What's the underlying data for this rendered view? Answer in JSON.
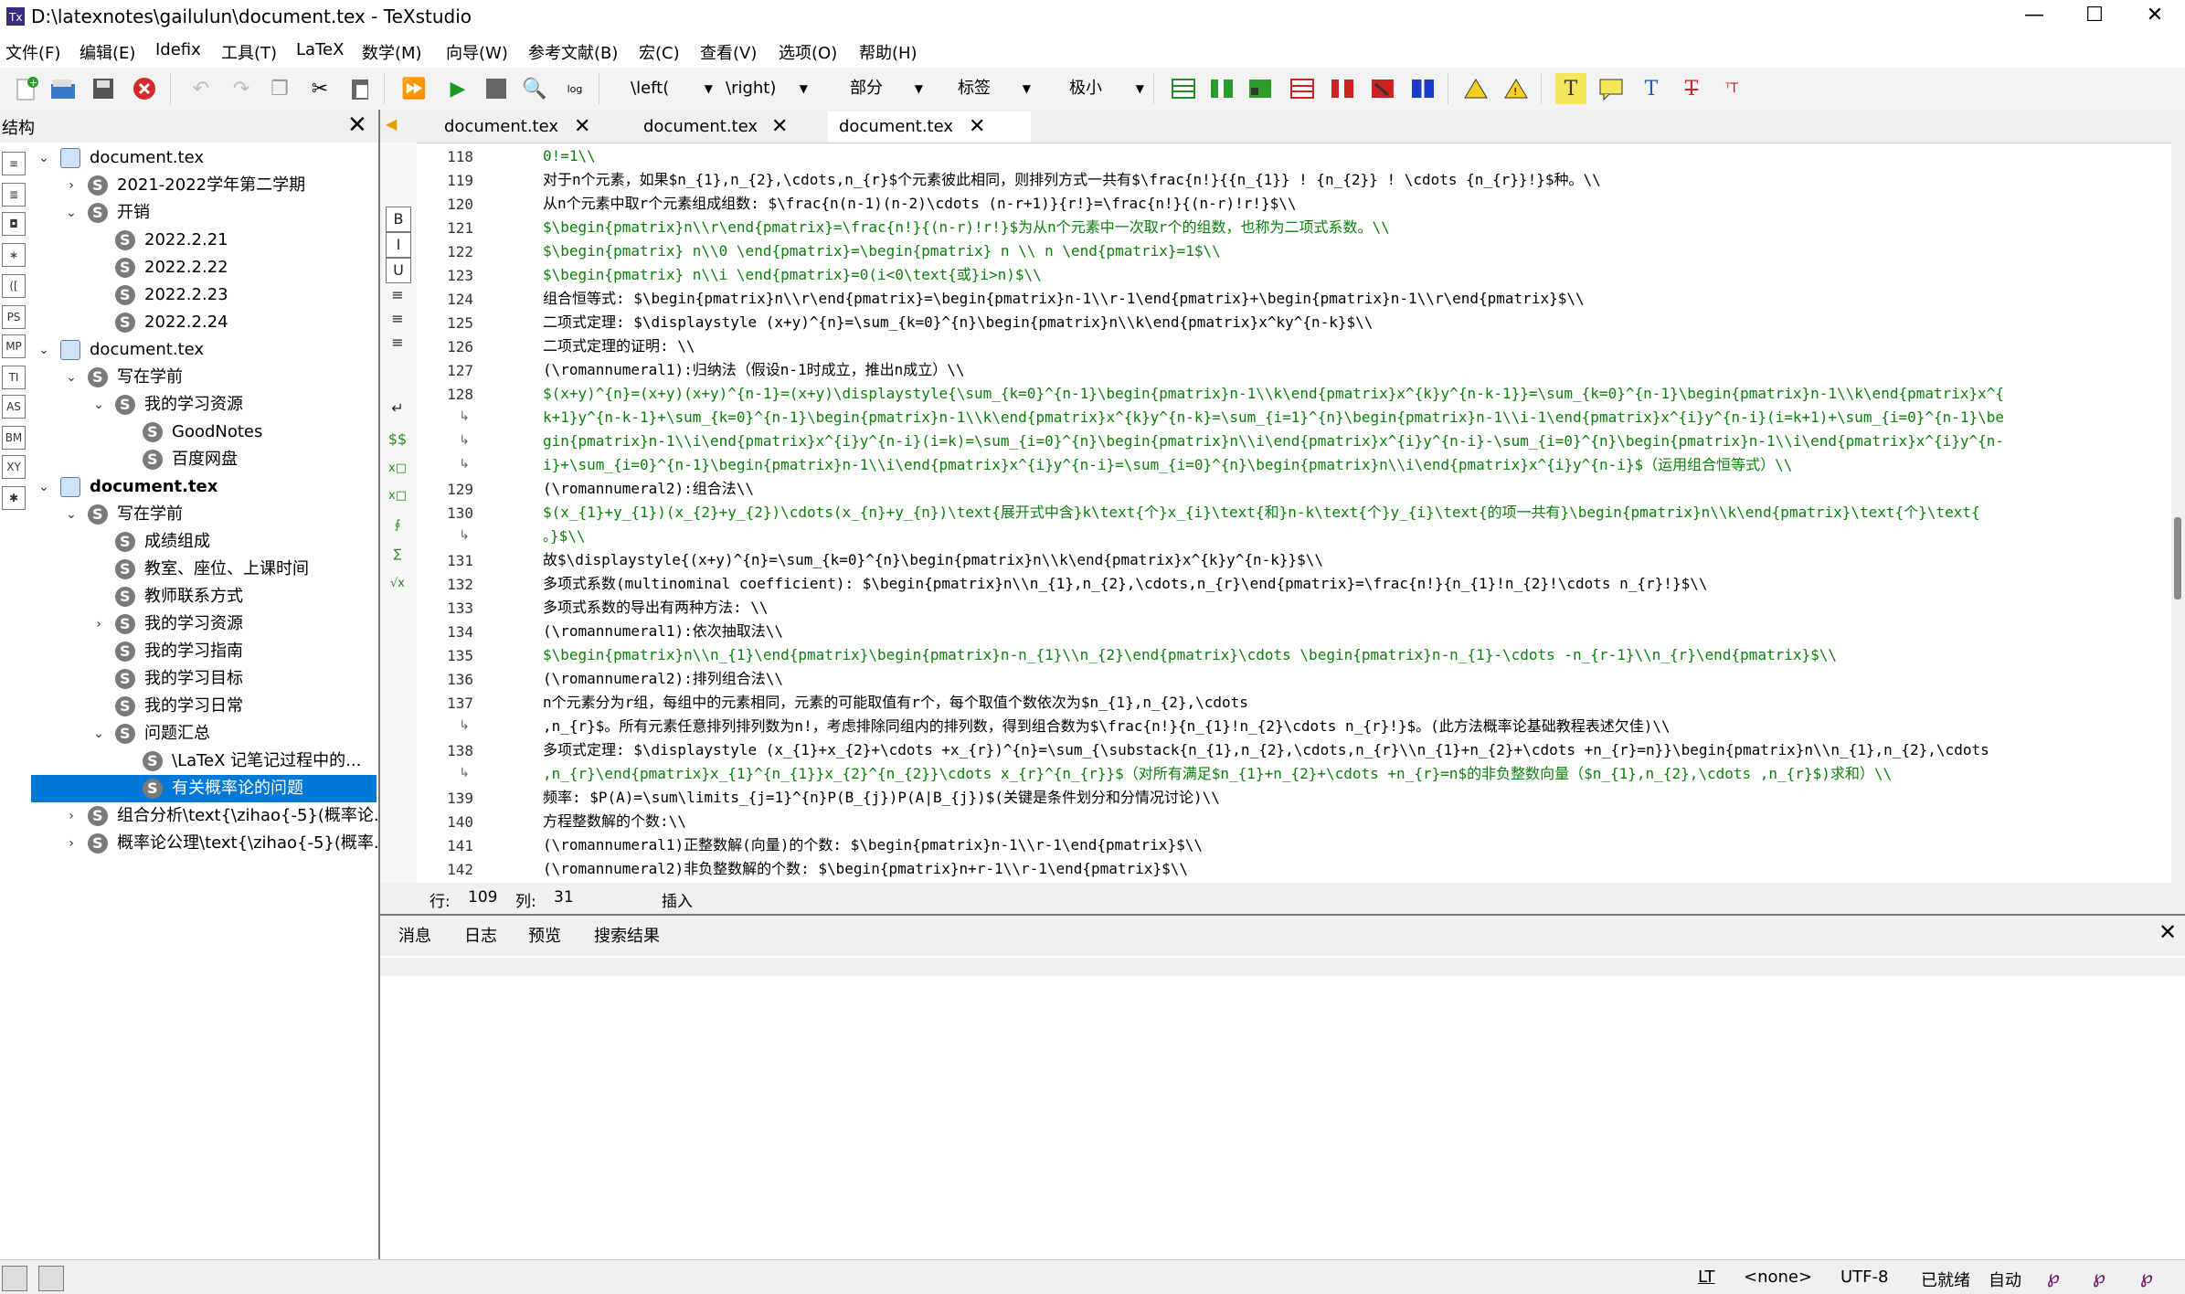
{
  "window": {
    "title": "D:\\latexnotes\\gailulun\\document.tex - TeXstudio",
    "minimize": "—",
    "maximize": "☐",
    "close": "✕"
  },
  "menu": [
    "文件(F)",
    "编辑(E)",
    "Idefix",
    "工具(T)",
    "LaTeX",
    "数学(M)",
    "向导(W)",
    "参考文献(B)",
    "宏(C)",
    "查看(V)",
    "选项(O)",
    "帮助(H)"
  ],
  "toolbar": {
    "combos": [
      "\\left(",
      "\\right)",
      "部分",
      "标签",
      "极小"
    ]
  },
  "structure": {
    "title": "结构",
    "close": "✕",
    "side_icons": [
      "≡",
      "≣",
      "◘",
      "∗",
      "([",
      "PS",
      "MP",
      "TI",
      "AS",
      "BM",
      "XY",
      "✱"
    ],
    "tree": [
      {
        "label": "document.tex",
        "level": 0,
        "type": "doc",
        "arrow": "⌄",
        "bold": false
      },
      {
        "label": "2021-2022学年第二学期",
        "level": 1,
        "type": "sec",
        "arrow": "›",
        "bold": false
      },
      {
        "label": "开销",
        "level": 1,
        "type": "sec",
        "arrow": "⌄",
        "bold": false
      },
      {
        "label": "2022.2.21",
        "level": 2,
        "type": "sec",
        "arrow": "",
        "bold": false
      },
      {
        "label": "2022.2.22",
        "level": 2,
        "type": "sec",
        "arrow": "",
        "bold": false
      },
      {
        "label": "2022.2.23",
        "level": 2,
        "type": "sec",
        "arrow": "",
        "bold": false
      },
      {
        "label": "2022.2.24",
        "level": 2,
        "type": "sec",
        "arrow": "",
        "bold": false
      },
      {
        "label": "document.tex",
        "level": 0,
        "type": "doc",
        "arrow": "⌄",
        "bold": false
      },
      {
        "label": "写在学前",
        "level": 1,
        "type": "sec",
        "arrow": "⌄",
        "bold": false
      },
      {
        "label": "我的学习资源",
        "level": 2,
        "type": "sec",
        "arrow": "⌄",
        "bold": false
      },
      {
        "label": "GoodNotes",
        "level": 3,
        "type": "sec",
        "arrow": "",
        "bold": false
      },
      {
        "label": "百度网盘",
        "level": 3,
        "type": "sec",
        "arrow": "",
        "bold": false
      },
      {
        "label": "document.tex",
        "level": 0,
        "type": "doc",
        "arrow": "⌄",
        "bold": true
      },
      {
        "label": "写在学前",
        "level": 1,
        "type": "sec",
        "arrow": "⌄",
        "bold": false
      },
      {
        "label": "成绩组成",
        "level": 2,
        "type": "sec",
        "arrow": "",
        "bold": false
      },
      {
        "label": "教室、座位、上课时间",
        "level": 2,
        "type": "sec",
        "arrow": "",
        "bold": false
      },
      {
        "label": "教师联系方式",
        "level": 2,
        "type": "sec",
        "arrow": "",
        "bold": false
      },
      {
        "label": "我的学习资源",
        "level": 2,
        "type": "sec",
        "arrow": "›",
        "bold": false
      },
      {
        "label": "我的学习指南",
        "level": 2,
        "type": "sec",
        "arrow": "",
        "bold": false
      },
      {
        "label": "我的学习目标",
        "level": 2,
        "type": "sec",
        "arrow": "",
        "bold": false
      },
      {
        "label": "我的学习日常",
        "level": 2,
        "type": "sec",
        "arrow": "",
        "bold": false
      },
      {
        "label": "问题汇总",
        "level": 2,
        "type": "sec",
        "arrow": "⌄",
        "bold": false
      },
      {
        "label": "\\LaTeX 记笔记过程中的...",
        "level": 3,
        "type": "sec",
        "arrow": "",
        "bold": false
      },
      {
        "label": "有关概率论的问题",
        "level": 3,
        "type": "sec",
        "arrow": "",
        "bold": false,
        "selected": true
      },
      {
        "label": "组合分析\\text{\\zihao{-5}(概率论...",
        "level": 1,
        "type": "sec",
        "arrow": "›",
        "bold": false
      },
      {
        "label": "概率论公理\\text{\\zihao{-5}(概率...",
        "level": 1,
        "type": "sec",
        "arrow": "›",
        "bold": false
      }
    ]
  },
  "editor": {
    "tabs": [
      "document.tex",
      "document.tex",
      "document.tex"
    ],
    "left_buttons": [
      "B",
      "I",
      "U",
      "≡",
      "≡",
      "≡",
      "↵",
      "$$",
      "x□",
      "x□",
      "∮",
      "∑",
      "√x"
    ],
    "lines": [
      {
        "n": "118",
        "text": "0!=1\\\\",
        "kind": "m"
      },
      {
        "n": "119",
        "text": "对于n个元素，如果$n_{1},n_{2},\\cdots,n_{r}$个元素彼此相同，则排列方式一共有$\\frac{n!}{{n_{1}} ! {n_{2}} ! \\cdots {n_{r}}!}$种。\\\\",
        "kind": "t"
      },
      {
        "n": "120",
        "text": "从n个元素中取r个元素组成组数: $\\frac{n(n-1)(n-2)\\cdots (n-r+1)}{r!}=\\frac{n!}{(n-r)!r!}$\\\\",
        "kind": "t"
      },
      {
        "n": "121",
        "text": "$\\begin{pmatrix}n\\\\r\\end{pmatrix}=\\frac{n!}{(n-r)!r!}$为从n个元素中一次取r个的组数，也称为二项式系数。\\\\",
        "kind": "m"
      },
      {
        "n": "122",
        "text": "$\\begin{pmatrix} n\\\\0 \\end{pmatrix}=\\begin{pmatrix} n \\\\ n \\end{pmatrix}=1$\\\\",
        "kind": "m"
      },
      {
        "n": "123",
        "text": "$\\begin{pmatrix} n\\\\i \\end{pmatrix}=0(i<0\\text{或}i>n)$\\\\",
        "kind": "m"
      },
      {
        "n": "124",
        "text": "组合恒等式: $\\begin{pmatrix}n\\\\r\\end{pmatrix}=\\begin{pmatrix}n-1\\\\r-1\\end{pmatrix}+\\begin{pmatrix}n-1\\\\r\\end{pmatrix}$\\\\",
        "kind": "t"
      },
      {
        "n": "125",
        "text": "二项式定理: $\\displaystyle (x+y)^{n}=\\sum_{k=0}^{n}\\begin{pmatrix}n\\\\k\\end{pmatrix}x^ky^{n-k}$\\\\",
        "kind": "t"
      },
      {
        "n": "126",
        "text": "二项式定理的证明: \\\\",
        "kind": "t"
      },
      {
        "n": "127",
        "text": "(\\romannumeral1):归纳法（假设n-1时成立，推出n成立）\\\\",
        "kind": "t"
      },
      {
        "n": "128",
        "text": "$(x+y)^{n}=(x+y)(x+y)^{n-1}=(x+y)\\displaystyle{\\sum_{k=0}^{n-1}\\begin{pmatrix}n-1\\\\k\\end{pmatrix}x^{k}y^{n-k-1}}=\\sum_{k=0}^{n-1}\\begin{pmatrix}n-1\\\\k\\end{pmatrix}x^{",
        "kind": "m"
      },
      {
        "n": "",
        "text": "k+1}y^{n-k-1}+\\sum_{k=0}^{n-1}\\begin{pmatrix}n-1\\\\k\\end{pmatrix}x^{k}y^{n-k}=\\sum_{i=1}^{n}\\begin{pmatrix}n-1\\\\i-1\\end{pmatrix}x^{i}y^{n-i}(i=k+1)+\\sum_{i=0}^{n-1}\\be",
        "kind": "m"
      },
      {
        "n": "",
        "text": "gin{pmatrix}n-1\\\\i\\end{pmatrix}x^{i}y^{n-i}(i=k)=\\sum_{i=0}^{n}\\begin{pmatrix}n\\\\i\\end{pmatrix}x^{i}y^{n-i}-\\sum_{i=0}^{n}\\begin{pmatrix}n-1\\\\i\\end{pmatrix}x^{i}y^{n-",
        "kind": "m"
      },
      {
        "n": "",
        "text": "i}+\\sum_{i=0}^{n-1}\\begin{pmatrix}n-1\\\\i\\end{pmatrix}x^{i}y^{n-i}=\\sum_{i=0}^{n}\\begin{pmatrix}n\\\\i\\end{pmatrix}x^{i}y^{n-i}$（运用组合恒等式）\\\\",
        "kind": "m"
      },
      {
        "n": "129",
        "text": "(\\romannumeral2):组合法\\\\",
        "kind": "t"
      },
      {
        "n": "130",
        "text": "$(x_{1}+y_{1})(x_{2}+y_{2})\\cdots(x_{n}+y_{n})\\text{展开式中含}k\\text{个}x_{i}\\text{和}n-k\\text{个}y_{i}\\text{的项一共有}\\begin{pmatrix}n\\\\k\\end{pmatrix}\\text{个}\\text{",
        "kind": "m"
      },
      {
        "n": "",
        "text": "。}$\\\\",
        "kind": "m"
      },
      {
        "n": "131",
        "text": "故$\\displaystyle{(x+y)^{n}=\\sum_{k=0}^{n}\\begin{pmatrix}n\\\\k\\end{pmatrix}x^{k}y^{n-k}}$\\\\",
        "kind": "t"
      },
      {
        "n": "132",
        "text": "多项式系数(multinominal coefficient): $\\begin{pmatrix}n\\\\n_{1},n_{2},\\cdots,n_{r}\\end{pmatrix}=\\frac{n!}{n_{1}!n_{2}!\\cdots n_{r}!}$\\\\",
        "kind": "t"
      },
      {
        "n": "133",
        "text": "多项式系数的导出有两种方法: \\\\",
        "kind": "t"
      },
      {
        "n": "134",
        "text": "(\\romannumeral1):依次抽取法\\\\",
        "kind": "t"
      },
      {
        "n": "135",
        "text": "$\\begin{pmatrix}n\\\\n_{1}\\end{pmatrix}\\begin{pmatrix}n-n_{1}\\\\n_{2}\\end{pmatrix}\\cdots \\begin{pmatrix}n-n_{1}-\\cdots -n_{r-1}\\\\n_{r}\\end{pmatrix}$\\\\",
        "kind": "m"
      },
      {
        "n": "136",
        "text": "(\\romannumeral2):排列组合法\\\\",
        "kind": "t"
      },
      {
        "n": "137",
        "text": "n个元素分为r组，每组中的元素相同，元素的可能取值有r个，每个取值个数依次为$n_{1},n_{2},\\cdots",
        "kind": "t"
      },
      {
        "n": "",
        "text": ",n_{r}$。所有元素任意排列排列数为n!，考虑排除同组内的排列数，得到组合数为$\\frac{n!}{n_{1}!n_{2}\\cdots n_{r}!}$。(此方法概率论基础教程表述欠佳)\\\\",
        "kind": "t"
      },
      {
        "n": "138",
        "text": "多项式定理: $\\displaystyle (x_{1}+x_{2}+\\cdots +x_{r})^{n}=\\sum_{\\substack{n_{1},n_{2},\\cdots,n_{r}\\\\n_{1}+n_{2}+\\cdots +n_{r}=n}}\\begin{pmatrix}n\\\\n_{1},n_{2},\\cdots",
        "kind": "t"
      },
      {
        "n": "",
        "text": ",n_{r}\\end{pmatrix}x_{1}^{n_{1}}x_{2}^{n_{2}}\\cdots x_{r}^{n_{r}}$（对所有满足$n_{1}+n_{2}+\\cdots +n_{r}=n$的非负整数向量（$n_{1},n_{2},\\cdots ,n_{r}$)求和）\\\\",
        "kind": "m"
      },
      {
        "n": "139",
        "text": "频率: $P(A)=\\sum\\limits_{j=1}^{n}P(B_{j})P(A|B_{j})$(关键是条件划分和分情况讨论)\\\\",
        "kind": "t"
      },
      {
        "n": "140",
        "text": "方程整数解的个数:\\\\",
        "kind": "t"
      },
      {
        "n": "141",
        "text": "(\\romannumeral1)正整数解(向量)的个数: $\\begin{pmatrix}n-1\\\\r-1\\end{pmatrix}$\\\\",
        "kind": "t"
      },
      {
        "n": "142",
        "text": "(\\romannumeral2)非负整数解的个数: $\\begin{pmatrix}n+r-1\\\\r-1\\end{pmatrix}$\\\\",
        "kind": "t"
      }
    ],
    "status": {
      "row_label": "行:",
      "row": "109",
      "col_label": "列:",
      "col": "31",
      "mode": "插入"
    }
  },
  "messages": {
    "tabs": [
      "消息",
      "日志",
      "预览",
      "搜索结果"
    ],
    "close": "✕"
  },
  "statusbar": {
    "lt": "LT",
    "lang": "<none>",
    "encoding": "UTF-8",
    "ready": "已就绪",
    "auto": "自动"
  },
  "colors": {
    "selection": "#0078d7",
    "math_green": "#0a7f0a"
  }
}
